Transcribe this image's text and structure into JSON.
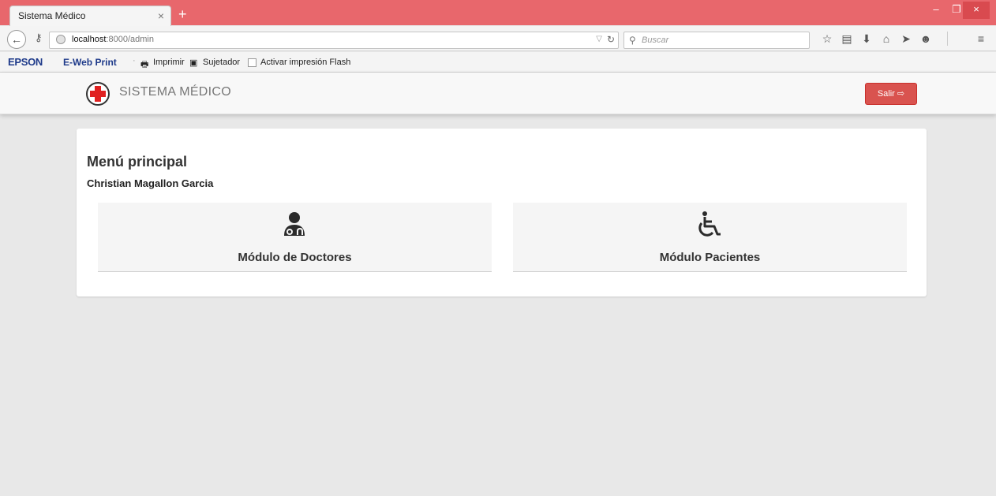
{
  "browser": {
    "tab_title": "Sistema Médico",
    "tab_close": "×",
    "new_tab": "+",
    "url_host": "localhost",
    "url_rest": ":8000/admin",
    "search_placeholder": "Buscar",
    "window_min": "–",
    "window_max": "❐",
    "window_close": "×"
  },
  "bookmarks": {
    "epson": "EPSON",
    "ewebprint": "E-Web Print",
    "separator": "·",
    "imprimir": "Imprimir",
    "sujetador": "Sujetador",
    "activar_flash": "Activar impresión Flash"
  },
  "header": {
    "brand": "SISTEMA MÉDICO",
    "logout_label": "Salir"
  },
  "main": {
    "title": "Menú principal",
    "user_name": "Christian Magallon Garcia",
    "modules": [
      {
        "label": "Módulo de Doctores",
        "icon": "doctor-icon"
      },
      {
        "label": "Módulo Pacientes",
        "icon": "wheelchair-icon"
      }
    ]
  },
  "colors": {
    "titlebar": "#e8676c",
    "logout_button": "#d9534f",
    "logo_cross": "#e02020",
    "page_background": "#e8e8e8"
  }
}
